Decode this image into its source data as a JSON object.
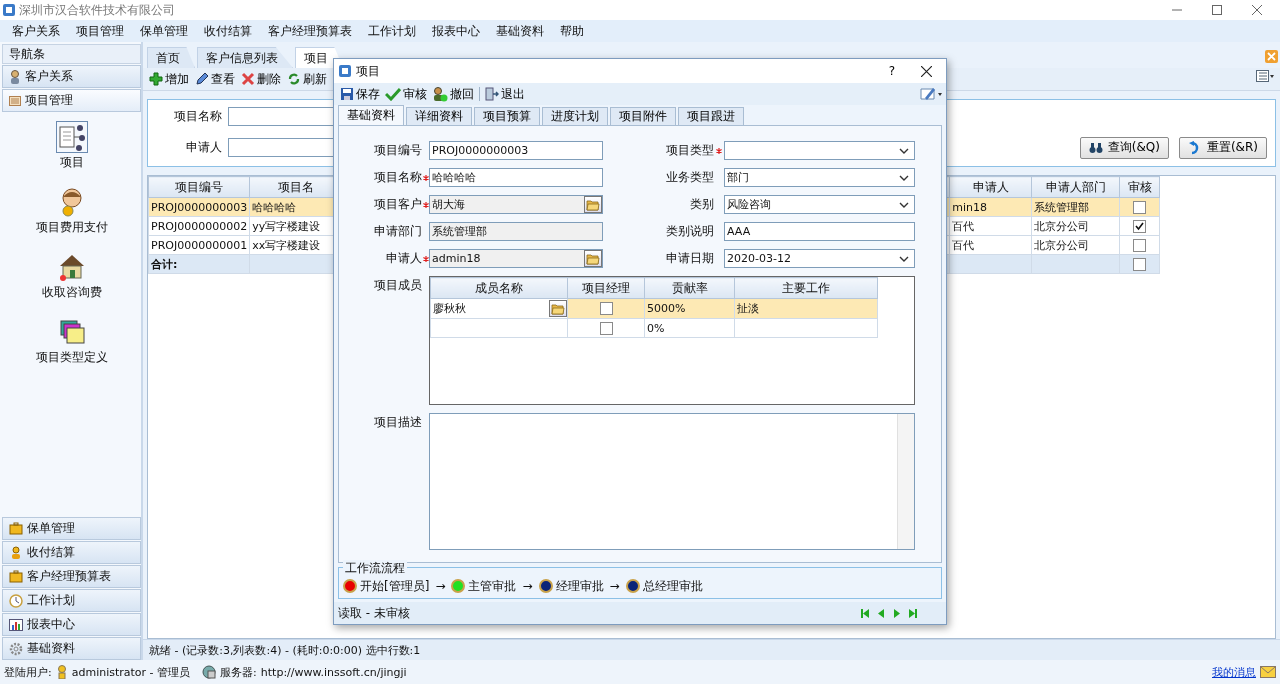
{
  "window": {
    "title": "深圳市汉合软件技术有限公司"
  },
  "menu": [
    "客户关系",
    "项目管理",
    "保单管理",
    "收付结算",
    "客户经理预算表",
    "工作计划",
    "报表中心",
    "基础资料",
    "帮助"
  ],
  "nav": {
    "title": "导航条",
    "groups_top": [
      {
        "label": "客户关系",
        "expanded": false
      },
      {
        "label": "项目管理",
        "expanded": true
      }
    ],
    "items": [
      {
        "label": "项目",
        "selected": true
      },
      {
        "label": "项目费用支付",
        "selected": false
      },
      {
        "label": "收取咨询费",
        "selected": false
      },
      {
        "label": "项目类型定义",
        "selected": false
      }
    ],
    "groups_bottom": [
      {
        "label": "保单管理",
        "expanded": false
      },
      {
        "label": "收付结算",
        "expanded": false
      },
      {
        "label": "客户经理预算表",
        "expanded": false
      },
      {
        "label": "工作计划",
        "expanded": false
      },
      {
        "label": "报表中心",
        "expanded": false
      },
      {
        "label": "基础资料",
        "expanded": false
      }
    ]
  },
  "tabs": [
    {
      "label": "首页",
      "selected": false
    },
    {
      "label": "客户信息列表",
      "selected": false
    },
    {
      "label": "项目",
      "selected": true
    }
  ],
  "toolbar": [
    "增加",
    "查看",
    "删除",
    "刷新"
  ],
  "search": {
    "fields": [
      {
        "label": "项目名称"
      },
      {
        "label": "申请人"
      }
    ],
    "buttons": [
      "查询(&Q)",
      "重置(&R)"
    ]
  },
  "table": {
    "columns": [
      "项目编号",
      "项目名",
      "申请人",
      "申请人部门",
      "审核"
    ],
    "rows": [
      {
        "cells": [
          "PROJ0000000003",
          "哈哈哈哈",
          "min18",
          "系统管理部"
        ],
        "audited": false,
        "selected": true
      },
      {
        "cells": [
          "PROJ0000000002",
          "yy写字楼建设",
          "百代",
          "北京分公司"
        ],
        "audited": true,
        "selected": false
      },
      {
        "cells": [
          "PROJ0000000001",
          "xx写字楼建设",
          "百代",
          "北京分公司"
        ],
        "audited": false,
        "selected": false
      }
    ],
    "total": {
      "label": "合计:",
      "audited": false
    }
  },
  "status_bar": "就绪 - (记录数:3,列表数:4) - (耗时:0:0:00) 选中行数:1",
  "footer": {
    "user_label": "登陆用户:",
    "user": "administrator - 管理员",
    "server_label": "服务器:",
    "server": "http://www.inssoft.cn/jingji",
    "messages": "我的消息"
  },
  "dialog": {
    "title": "项目",
    "help": "?",
    "toolbar": [
      "保存",
      "审核",
      "撤回",
      "退出"
    ],
    "tabs": [
      {
        "label": "基础资料",
        "selected": true
      },
      {
        "label": "详细资料",
        "selected": false
      },
      {
        "label": "项目预算",
        "selected": false
      },
      {
        "label": "进度计划",
        "selected": false
      },
      {
        "label": "项目附件",
        "selected": false
      },
      {
        "label": "项目跟进",
        "selected": false
      }
    ],
    "fields_left": [
      {
        "label": "项目编号",
        "value": "PROJ0000000003",
        "kind": "text",
        "required": false,
        "readonly": false
      },
      {
        "label": "项目名称",
        "value": "哈哈哈哈",
        "kind": "text",
        "required": true,
        "readonly": false
      },
      {
        "label": "项目客户",
        "value": "胡大海",
        "kind": "lookup",
        "required": true,
        "readonly": true
      },
      {
        "label": "申请部门",
        "value": "系统管理部",
        "kind": "text",
        "required": false,
        "readonly": true
      },
      {
        "label": "申请人",
        "value": "admin18",
        "kind": "lookup",
        "required": true,
        "readonly": true
      }
    ],
    "fields_right": [
      {
        "label": "项目类型",
        "kind": "select",
        "required": true,
        "readonly": false
      },
      {
        "label": "业务类型",
        "value": "部门",
        "kind": "select",
        "required": false,
        "readonly": false
      },
      {
        "label": "类别",
        "value": "风险咨询",
        "kind": "select",
        "required": false,
        "readonly": false
      },
      {
        "label": "类别说明",
        "value": "AAA",
        "kind": "text",
        "required": false,
        "readonly": false
      },
      {
        "label": "申请日期",
        "value": "2020-03-12",
        "kind": "select",
        "required": false,
        "readonly": false
      }
    ],
    "members": {
      "label": "项目成员",
      "columns": [
        "成员名称",
        "项目经理",
        "贡献率",
        "主要工作"
      ],
      "rows": [
        {
          "name": "廖秋秋",
          "manager": false,
          "rate": "5000%",
          "work": "扯淡",
          "selected": true
        },
        {
          "manager": false,
          "rate": "0%",
          "selected": false
        }
      ]
    },
    "description": {
      "label": "项目描述"
    },
    "workflow": {
      "title": "工作流流程",
      "steps": [
        {
          "label": "开始[管理员]",
          "color": "#e80000",
          "next": "→"
        },
        {
          "label": "主管审批",
          "color": "#22e022",
          "next": "→"
        },
        {
          "label": "经理审批",
          "color": "#0a2478",
          "next": "→"
        },
        {
          "label": "总经理审批",
          "color": "#0a2478"
        }
      ]
    },
    "status": "读取 - 未审核"
  }
}
